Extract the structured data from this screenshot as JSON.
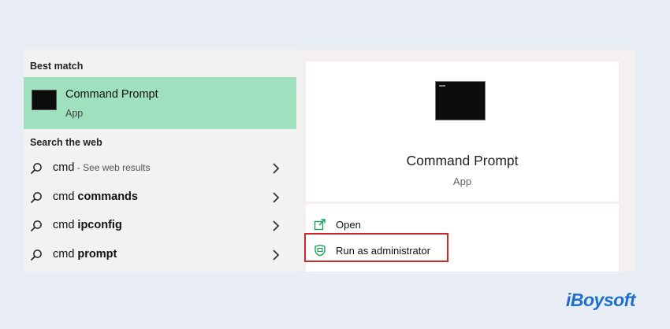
{
  "search_panel": {
    "best_match_heading": "Best match",
    "best_match": {
      "title": "Command Prompt",
      "subtitle": "App"
    },
    "web_heading": "Search the web",
    "web_results": [
      {
        "prefix": "cmd",
        "bold": "",
        "suffix": " - See web results"
      },
      {
        "prefix": "cmd ",
        "bold": "commands",
        "suffix": ""
      },
      {
        "prefix": "cmd ",
        "bold": "ipconfig",
        "suffix": ""
      },
      {
        "prefix": "cmd ",
        "bold": "prompt",
        "suffix": ""
      }
    ]
  },
  "detail_panel": {
    "title": "Command Prompt",
    "subtitle": "App",
    "actions": [
      {
        "label": "Open",
        "icon": "open-icon"
      },
      {
        "label": "Run as administrator",
        "icon": "shield-icon"
      }
    ]
  },
  "watermark": {
    "text": "iBoysoft"
  },
  "colors": {
    "highlight_row": "#9fe0bf",
    "annotation_box": "#cc2a2a",
    "logo": "#1e6ecd",
    "action_icon": "#1a9e5a"
  }
}
